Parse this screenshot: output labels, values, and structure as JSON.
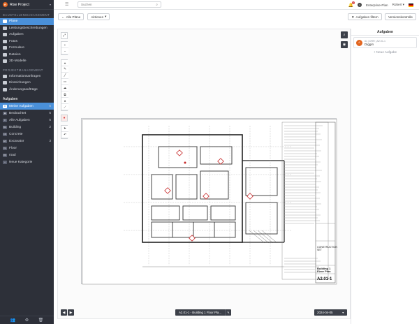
{
  "project": {
    "name": "Rise Project",
    "logo": "R"
  },
  "sidebar": {
    "section_building": "BAUSTELLENMANAGEMENT",
    "building_items": [
      {
        "label": "Pläne",
        "icon": "plans-icon",
        "active": true
      },
      {
        "label": "Leistungsbeschreibungen",
        "icon": "specs-icon"
      },
      {
        "label": "Aufgaben",
        "icon": "tasks-icon"
      },
      {
        "label": "Fotos",
        "icon": "photos-icon"
      },
      {
        "label": "Formulare",
        "icon": "forms-icon"
      },
      {
        "label": "Dateien",
        "icon": "files-icon"
      },
      {
        "label": "3D-Modelle",
        "icon": "cube-icon"
      }
    ],
    "section_project": "PROJEKTMANAGEMENT",
    "project_items": [
      {
        "label": "Informationsanfragen",
        "icon": "rfi-icon"
      },
      {
        "label": "Einreichungen",
        "icon": "submittals-icon"
      },
      {
        "label": "Änderungsaufträge",
        "icon": "change-orders-icon"
      }
    ],
    "tasks_header": "Aufgaben",
    "task_filters": [
      {
        "label": "Meine Aufgaben",
        "count": "5",
        "badge": "★",
        "active": true
      },
      {
        "label": "Beobachtet",
        "count": "5",
        "badge": "◉"
      },
      {
        "label": "Alle Aufgaben",
        "count": "5",
        "badge": "≡"
      },
      {
        "label": "Building",
        "count": "2",
        "badge": "BU"
      },
      {
        "label": "Concrete",
        "count": "",
        "badge": "CO"
      },
      {
        "label": "Excavator",
        "count": "3",
        "badge": "EX"
      },
      {
        "label": "Floor",
        "count": "",
        "badge": "FL"
      },
      {
        "label": "road",
        "count": "",
        "badge": "RO"
      },
      {
        "label": "Neue Kategorie",
        "count": "",
        "badge": "+"
      }
    ]
  },
  "topbar": {
    "search_placeholder": "Suchen",
    "notifications_count": "1",
    "plan_label": "Enterprise-Plan",
    "user_name": "Robert"
  },
  "actionbar": {
    "back_label": "Alle Pläne",
    "actions_label": "Aktionen",
    "filter_label": "Aufgaben filtern",
    "version_label": "Versionskontrolle"
  },
  "viewer": {
    "plan_title": "A2.01-1 - Building 1 Floor Pla...",
    "plan_date": "2024-04-05",
    "sheet_number": "A2.01-1",
    "sheet_title": "Building 1\nFloor Plan",
    "sheet_stamp": "CONSTRUCTION\nSET"
  },
  "tasks_panel": {
    "title": "Aufgaben",
    "tasks": [
      {
        "id": "#1 | DRR | A2.01-1",
        "name": "Diggin",
        "icon": "hazard-icon"
      }
    ],
    "new_task_label": "+ Neue Aufgabe"
  },
  "colors": {
    "sidebar_bg": "#2d3039",
    "accent": "#4a90d9",
    "brand": "#e2651f"
  }
}
